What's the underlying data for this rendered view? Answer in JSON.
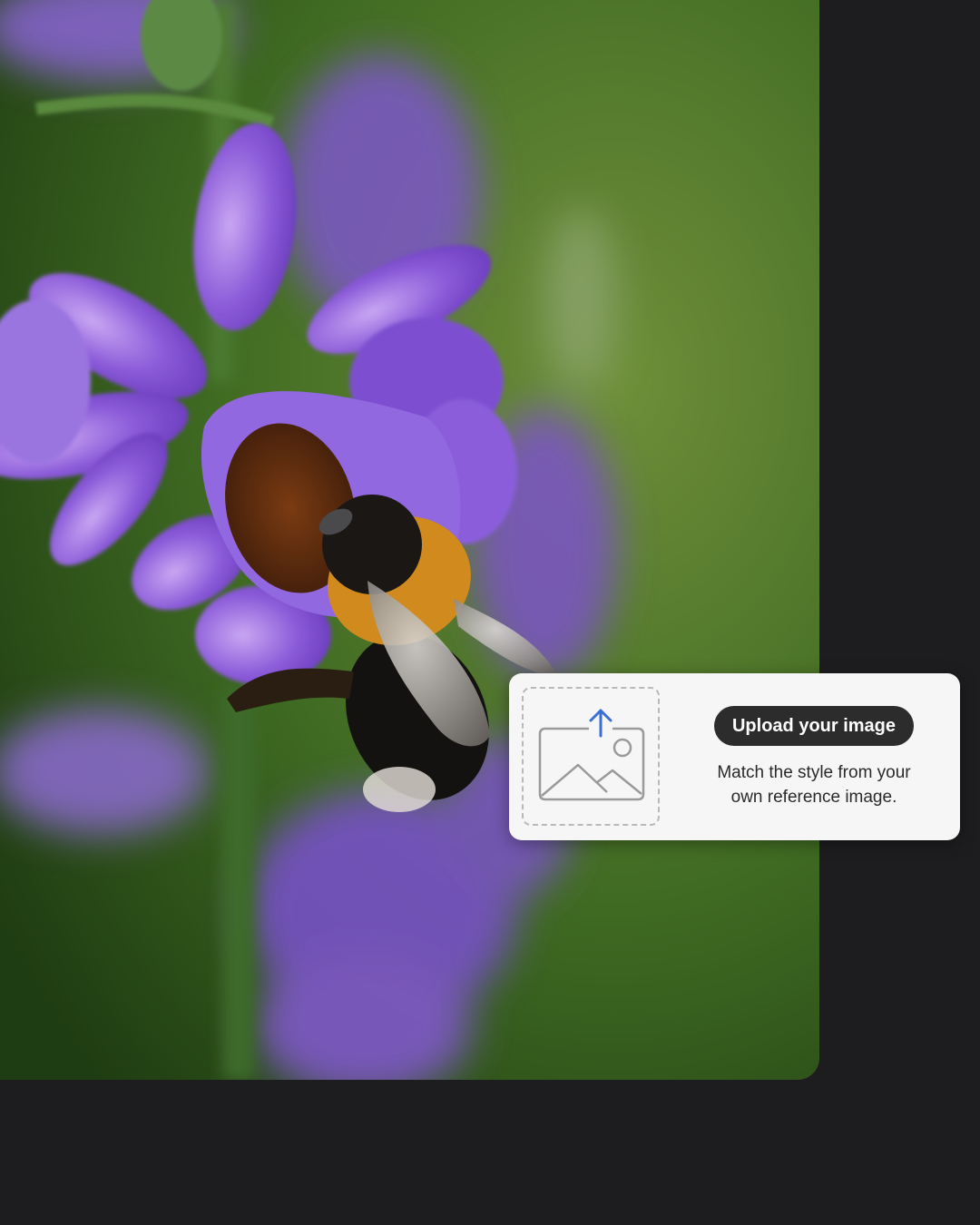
{
  "photo": {
    "subject_icon": "bumblebee-on-purple-flower-photo"
  },
  "upload_card": {
    "button_label": "Upload your image",
    "description_line1": "Match the style from your",
    "description_line2": "own reference image.",
    "dropzone_icon": "image-upload-icon"
  },
  "colors": {
    "background": "#1d1d1f",
    "card": "#f6f6f6",
    "button": "#2c2c2c",
    "upload_arrow": "#3a6fd8"
  }
}
